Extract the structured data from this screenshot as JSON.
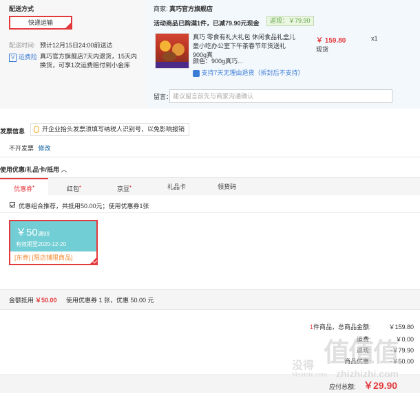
{
  "shipping": {
    "section_title": "配送方式",
    "method_button": "快递运输",
    "time_label": "配送时间:",
    "time_value": "预计12月15日24:00前送达",
    "insurance_tag": "运费险",
    "insurance_text": "真巧官方旗舰店7天内退货，15天内换货，可享1次运费赔付到小金库"
  },
  "order": {
    "merchant_label": "商家:",
    "merchant_name": "真巧官方旗舰店",
    "promo_text": "活动商品已购满1件，已减79.90元现金",
    "return_tag": "返现：￥79.90",
    "product_title": "真巧 零食有礼大礼包 休闲食品礼盒儿童小吃办公室下午茶春节年货送礼 900g真",
    "price": "￥ 159.80",
    "quantity": "x1",
    "stock": "现货",
    "color_label": "颜色：",
    "color_value": "900g真巧...",
    "guarantee": "支持7天无理由退货",
    "guarantee_note": "（拆封后不支持）",
    "message_label": "留言：",
    "message_placeholder": "建议留言前先与商家沟通确认"
  },
  "invoice": {
    "title": "发票信息",
    "tip": "开企业抬头发票须填写纳税人识别号，以免影响报销",
    "current": "不开发票",
    "edit_link": "修改"
  },
  "coupons": {
    "section_title": "使用优惠/礼品卡/抵用",
    "tabs": [
      "优惠券",
      "红包",
      "京豆",
      "礼品卡",
      "领货码"
    ],
    "tab_marks": [
      "•",
      "•",
      "•",
      "",
      ""
    ],
    "combo_text": "优惠组合推荐，共抵用50.00元；使用优惠券1张",
    "coupon": {
      "amount": "￥50",
      "condition": "满99",
      "validity": "有效期至2020-12-20",
      "tags": "[东券]  [限店铺限商品]"
    },
    "discount_label": "金额抵用",
    "discount_amount": "￥50.00",
    "discount_detail": "使用优惠券 1 张，优惠 50.00 元"
  },
  "summary": {
    "count": "1",
    "count_suffix": "件商品，总商品金额:",
    "total": "￥159.80",
    "freight_label": "运费:",
    "freight_value": "￥0.00",
    "cashback_label": "返现:",
    "cashback_value": "-￥79.90",
    "coupon_label": "商品优惠:",
    "coupon_value": "-￥50.00",
    "payable_label": "应付总额:",
    "payable_value": "￥29.90"
  },
  "watermark": {
    "main": "值值值",
    "sub": "没得",
    "url": "zhizhizhi.com",
    "url2": "Meidebi.com"
  },
  "colors": {
    "accent": "#e4393c",
    "link": "#005aa0",
    "coupon": "#71ced4"
  }
}
